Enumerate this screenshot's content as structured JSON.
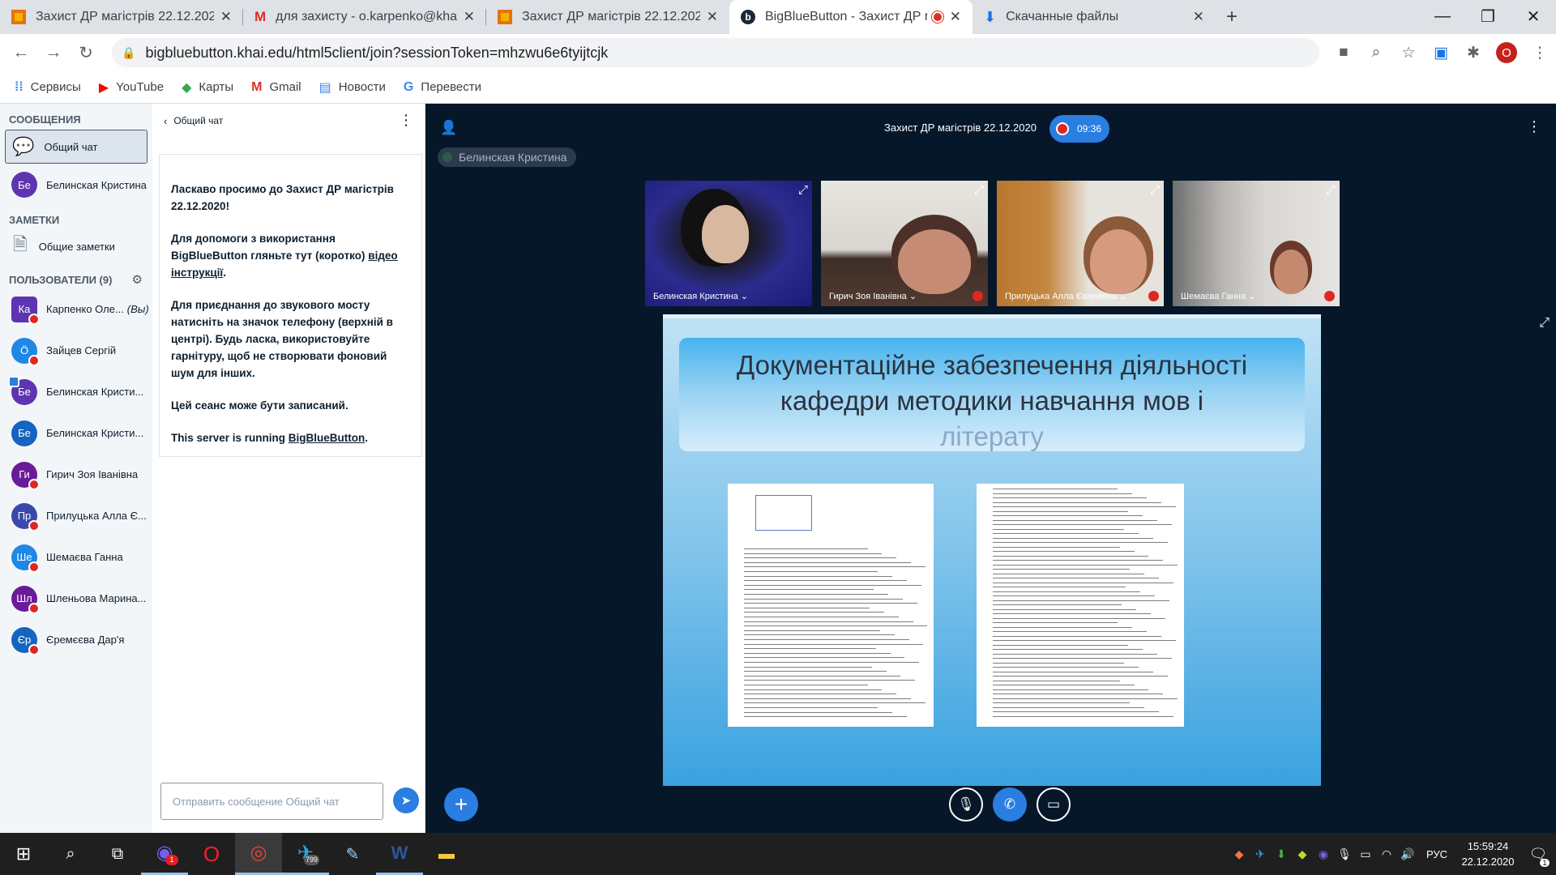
{
  "browser": {
    "tabs": [
      {
        "title": "Захист ДР магістрів 22.12.2020",
        "icon": "slides-icon",
        "active": false
      },
      {
        "title": "для захисту - o.karpenko@khai.e",
        "icon": "gmail-icon",
        "active": false
      },
      {
        "title": "Захист ДР магістрів 22.12.2020",
        "icon": "slides-icon",
        "active": false
      },
      {
        "title": "BigBlueButton - Захист ДР м",
        "icon": "bbb-icon",
        "active": true
      },
      {
        "title": "Скачанные файлы",
        "icon": "download-icon",
        "active": false
      }
    ],
    "url": "bigbluebutton.khai.edu/html5client/join?sessionToken=mhzwu6e6tyijtcjk",
    "profile_initial": "O",
    "bookmarks": [
      {
        "label": "Сервисы",
        "icon": "apps-grid-icon"
      },
      {
        "label": "YouTube",
        "icon": "youtube-icon"
      },
      {
        "label": "Карты",
        "icon": "maps-icon"
      },
      {
        "label": "Gmail",
        "icon": "gmail-icon"
      },
      {
        "label": "Новости",
        "icon": "news-icon"
      },
      {
        "label": "Перевести",
        "icon": "translate-icon"
      }
    ]
  },
  "sidebar": {
    "messages_title": "СООБЩЕНИЯ",
    "public_chat": "Общий чат",
    "private_chat": {
      "initials": "Бе",
      "name": "Белинская Кристина"
    },
    "notes_title": "ЗАМЕТКИ",
    "shared_notes": "Общие заметки",
    "users_title": "ПОЛЬЗОВАТЕЛИ (9)",
    "users": [
      {
        "initials": "Ка",
        "name": "Карпенко Оле...",
        "suffix": "(Вы)",
        "color": "#5e35b1",
        "moderator": true,
        "muted": true,
        "presenter": false
      },
      {
        "initials": "Ö",
        "name": "Зайцев Сергій",
        "suffix": "",
        "color": "#1e88e5",
        "moderator": false,
        "muted": true,
        "presenter": false
      },
      {
        "initials": "Бе",
        "name": "Белинская Кристи...",
        "suffix": "",
        "color": "#5e35b1",
        "moderator": false,
        "muted": false,
        "presenter": true
      },
      {
        "initials": "Бе",
        "name": "Белинская Кристи...",
        "suffix": "",
        "color": "#1565c0",
        "moderator": false,
        "muted": false,
        "presenter": false
      },
      {
        "initials": "Ги",
        "name": "Гирич Зоя Іванівна",
        "suffix": "",
        "color": "#6a1b9a",
        "moderator": false,
        "muted": true,
        "presenter": false
      },
      {
        "initials": "Пр",
        "name": "Прилуцька Алла Є...",
        "suffix": "",
        "color": "#3949ab",
        "moderator": false,
        "muted": true,
        "presenter": false
      },
      {
        "initials": "Ше",
        "name": "Шемаєва Ганна",
        "suffix": "",
        "color": "#1e88e5",
        "moderator": false,
        "muted": true,
        "presenter": false
      },
      {
        "initials": "Шл",
        "name": "Шленьова Марина...",
        "suffix": "",
        "color": "#6a1b9a",
        "moderator": false,
        "muted": true,
        "presenter": false
      },
      {
        "initials": "Єр",
        "name": "Єремєєва Дар'я",
        "suffix": "",
        "color": "#1565c0",
        "moderator": false,
        "muted": true,
        "presenter": false
      }
    ]
  },
  "chat": {
    "header": "Общий чат",
    "welcome_1": "Ласкаво просимо до Захист ДР магістрів 22.12.2020!",
    "welcome_2a": "Для допомоги з використання BigBlueButton гляньте тут (коротко) ",
    "welcome_2_link": "відео інструкції",
    "welcome_3": "Для приєднання до звукового мосту натисніть на значок телефону (верхній в центрі). Будь ласка, використовуйте гарнітуру, щоб не створювати фоновий шум для інших.",
    "welcome_4": "Цей сеанс може бути записаний.",
    "welcome_5a": "This server is running ",
    "welcome_5_link": "BigBlueButton",
    "input_placeholder": "Отправить сообщение Общий чат"
  },
  "meeting": {
    "title": "Захист ДР магістрів 22.12.2020",
    "recording_time": "09:36",
    "talking": "Белинская Кристина",
    "webcams": [
      {
        "name": "Белинская Кристина",
        "muted": false
      },
      {
        "name": "Гирич Зоя Іванівна",
        "muted": true
      },
      {
        "name": "Прилуцька Алла Євгенівна",
        "muted": true
      },
      {
        "name": "Шемаєва Ганна",
        "muted": true
      }
    ],
    "slide_title_1": "Документаційне забезпечення діяльності",
    "slide_title_2": "кафедри методики навчання мов і",
    "slide_title_3": "літерату"
  },
  "taskbar": {
    "viber_badge": "1",
    "telegram_badge": "799",
    "lang": "РУС",
    "time": "15:59:24",
    "date": "22.12.2020",
    "notification_count": "1"
  }
}
